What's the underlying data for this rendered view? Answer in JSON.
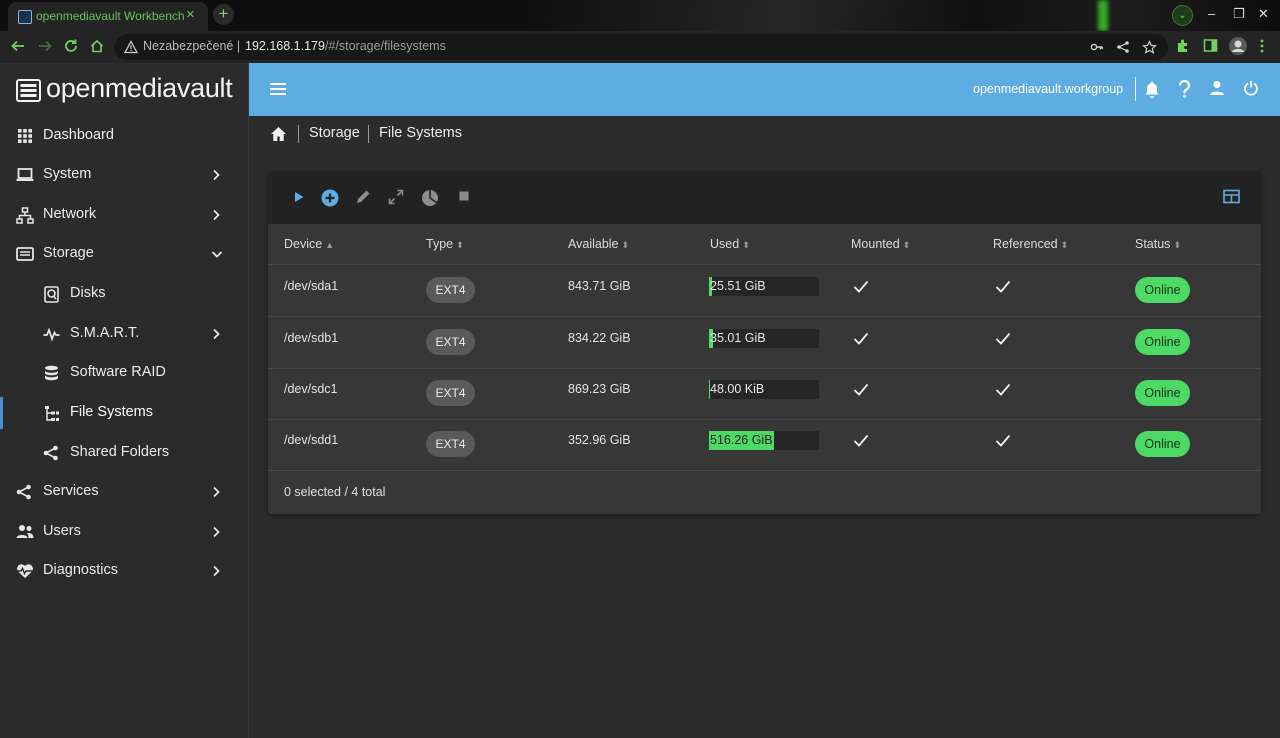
{
  "browser": {
    "tab_title": "openmediavault Workbench",
    "tab_close": "×",
    "new_tab": "+",
    "window_controls": [
      "–",
      "❐",
      "✕"
    ],
    "security_label": "Nezabezpečené",
    "url_host": "192.168.1.179",
    "url_path": "/#/storage/filesystems"
  },
  "sidebar": {
    "brand": "openmediavault",
    "items": [
      {
        "label": "Dashboard",
        "icon": "dashboard-icon"
      },
      {
        "label": "System",
        "icon": "laptop-icon"
      },
      {
        "label": "Network",
        "icon": "network-icon"
      },
      {
        "label": "Storage",
        "icon": "storage-icon"
      },
      {
        "label": "Disks",
        "icon": "disk-icon"
      },
      {
        "label": "S.M.A.R.T.",
        "icon": "pulse-icon"
      },
      {
        "label": "Software RAID",
        "icon": "database-icon"
      },
      {
        "label": "File Systems",
        "icon": "filesystem-tree-icon"
      },
      {
        "label": "Shared Folders",
        "icon": "share-icon"
      },
      {
        "label": "Services",
        "icon": "share-icon"
      },
      {
        "label": "Users",
        "icon": "users-icon"
      },
      {
        "label": "Diagnostics",
        "icon": "heart-pulse-icon"
      }
    ]
  },
  "topbar": {
    "hostname": "openmediavault.workgroup"
  },
  "breadcrumb": [
    "Storage",
    "File Systems"
  ],
  "table": {
    "columns": [
      "Device",
      "Type",
      "Available",
      "Used",
      "Mounted",
      "Referenced",
      "Status"
    ],
    "sort_indicator_active": "▲",
    "sort_indicator": "⬍",
    "rows": [
      {
        "device": "/dev/sda1",
        "type": "EXT4",
        "available": "843.71 GiB",
        "used": "25.51 GiB",
        "used_fraction": 0.03,
        "status": "Online"
      },
      {
        "device": "/dev/sdb1",
        "type": "EXT4",
        "available": "834.22 GiB",
        "used": "35.01 GiB",
        "used_fraction": 0.04,
        "status": "Online"
      },
      {
        "device": "/dev/sdc1",
        "type": "EXT4",
        "available": "869.23 GiB",
        "used": "48.00 KiB",
        "used_fraction": 0.01,
        "status": "Online"
      },
      {
        "device": "/dev/sdd1",
        "type": "EXT4",
        "available": "352.96 GiB",
        "used": "516.26 GiB",
        "used_fraction": 0.59,
        "status": "Online"
      }
    ],
    "footer": "0 selected / 4 total"
  },
  "colors": {
    "accent": "#5dade2",
    "online": "#4cd964",
    "toolbar_active_icon": "#5dade2"
  }
}
